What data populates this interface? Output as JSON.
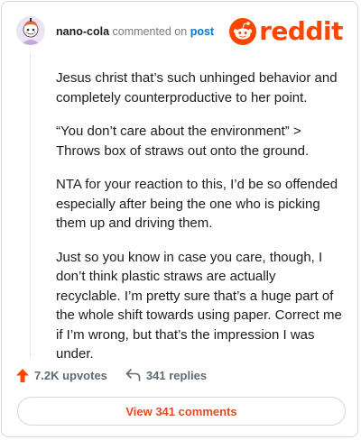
{
  "header": {
    "username": "nano-cola",
    "commented_text": "commented on",
    "post_link": "post",
    "logo_text": "reddit"
  },
  "comment": {
    "paragraphs": [
      "Jesus christ that’s such unhinged behavior and completely counterproductive to her point.",
      "“You don’t care about the environment” > Throws box of straws out onto the ground.",
      "NTA for your reaction to this, I’d be so offended especially after being the one who is picking them up and driving them.",
      "Just so you know in case you care, though, I don’t think plastic straws are actually recyclable. I’m pretty sure that’s a huge part of the whole shift towards using paper. Correct me if I’m wrong, but that’s the impression I was under."
    ]
  },
  "actions": {
    "upvotes": "7.2K upvotes",
    "replies": "341 replies"
  },
  "view_comments_label": "View 341 comments",
  "colors": {
    "brand": "#ff4500",
    "upvote_arrow": "#ff4500",
    "link": "#0079d3",
    "action_text": "#5c6c74",
    "view_button_text": "#e34a1f",
    "border": "#d7d7d7"
  },
  "icons": {
    "upvote": "upvote-arrow-icon",
    "reply": "reply-arrow-icon",
    "logo": "snoo-icon",
    "avatar": "avatar"
  }
}
